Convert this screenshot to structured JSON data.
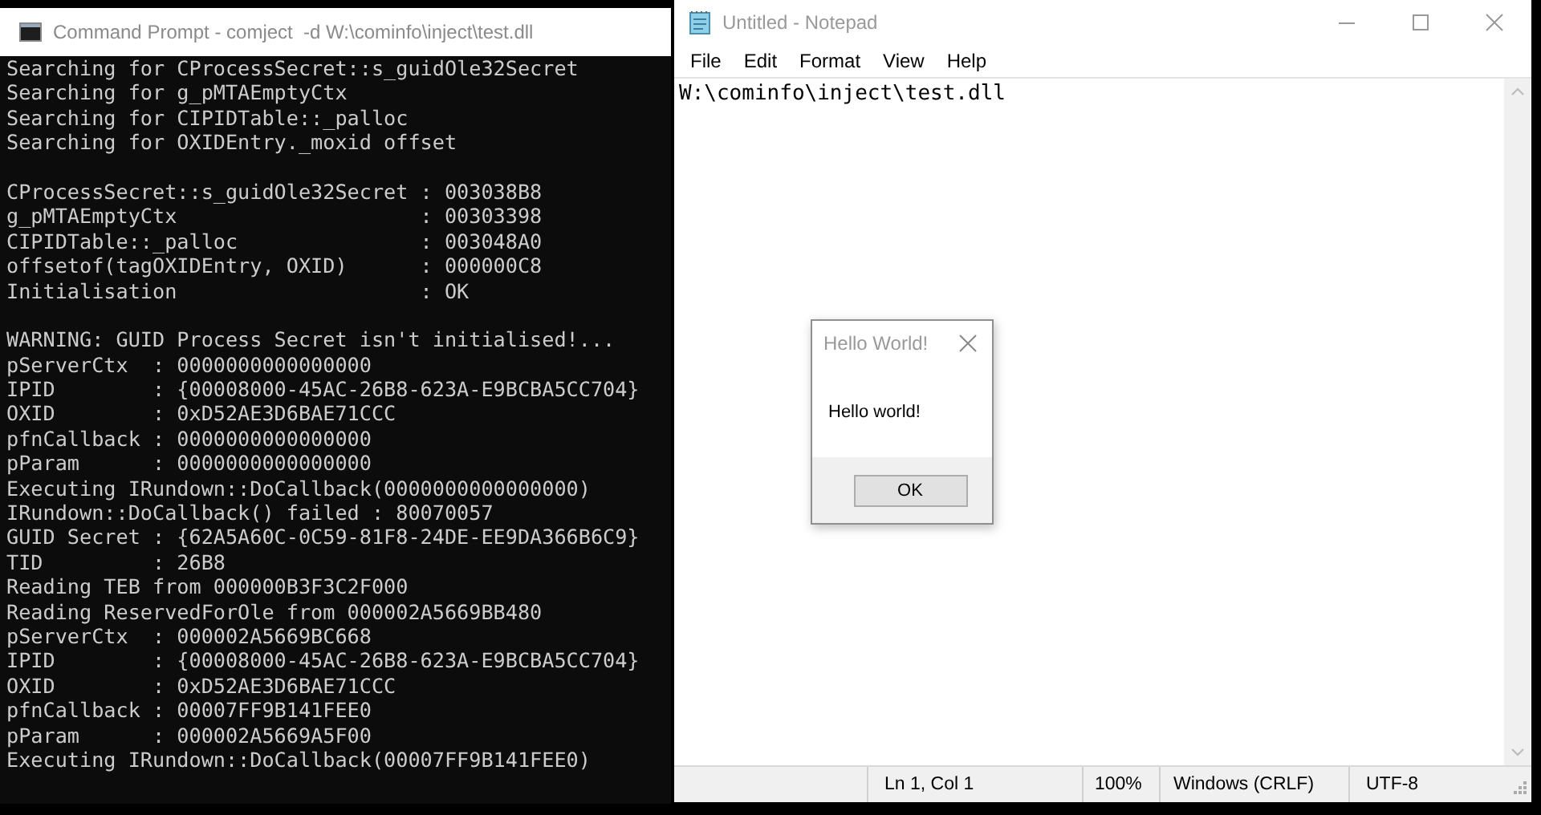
{
  "console": {
    "title": "Command Prompt - comject  -d W:\\cominfo\\inject\\test.dll",
    "blocks": [
      [
        "Searching for CProcessSecret::s_guidOle32Secret",
        "Searching for g_pMTAEmptyCtx",
        "Searching for CIPIDTable::_palloc",
        "Searching for OXIDEntry._moxid offset"
      ],
      [
        "CProcessSecret::s_guidOle32Secret : 003038B8",
        "g_pMTAEmptyCtx                    : 00303398",
        "CIPIDTable::_palloc               : 003048A0",
        "offsetof(tagOXIDEntry, OXID)      : 000000C8",
        "Initialisation                    : OK"
      ],
      [
        "WARNING: GUID Process Secret isn't initialised!...",
        "pServerCtx  : 0000000000000000",
        "IPID        : {00008000-45AC-26B8-623A-E9BCBA5CC704}",
        "OXID        : 0xD52AE3D6BAE71CCC",
        "pfnCallback : 0000000000000000",
        "pParam      : 0000000000000000",
        "Executing IRundown::DoCallback(0000000000000000)",
        "IRundown::DoCallback() failed : 80070057",
        "GUID Secret : {62A5A60C-0C59-81F8-24DE-EE9DA366B6C9}",
        "TID         : 26B8",
        "Reading TEB from 000000B3F3C2F000",
        "Reading ReservedForOle from 000002A5669BB480",
        "pServerCtx  : 000002A5669BC668",
        "IPID        : {00008000-45AC-26B8-623A-E9BCBA5CC704}",
        "OXID        : 0xD52AE3D6BAE71CCC",
        "pfnCallback : 00007FF9B141FEE0",
        "pParam      : 000002A5669A5F00",
        "Executing IRundown::DoCallback(00007FF9B141FEE0)"
      ]
    ]
  },
  "notepad": {
    "title": "Untitled - Notepad",
    "menu": [
      "File",
      "Edit",
      "Format",
      "View",
      "Help"
    ],
    "text": "W:\\cominfo\\inject\\test.dll",
    "status": [
      "Ln 1, Col 1",
      "100%",
      "Windows (CRLF)",
      "UTF-8"
    ]
  },
  "dialog": {
    "title": "Hello World!",
    "message": "Hello world!",
    "buttons": [
      "OK"
    ]
  }
}
